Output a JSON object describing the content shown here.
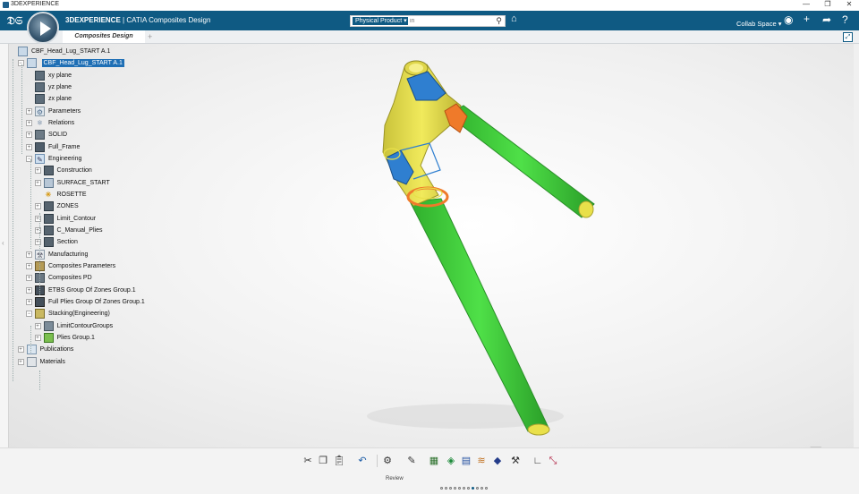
{
  "window": {
    "title": "3DEXPERIENCE",
    "minimize": "—",
    "restore": "❐",
    "close": "✕"
  },
  "topbar": {
    "brand_bold": "3DEXPERIENCE",
    "brand_rest": " | CATIA Composites Design",
    "search_scope": "Physical Product ▾",
    "search_placeholder": "in",
    "collab_space": "Collab Space ▾",
    "accent_color": "#0f5a83"
  },
  "tabs": {
    "active": "Composites Design",
    "add": "+"
  },
  "tree": [
    {
      "label": "CBF_Head_Lug_START A.1",
      "level": 0,
      "icon": "product-icon",
      "expander": "",
      "selected": false
    },
    {
      "label": "CBF_Head_Lug_START A.1",
      "level": 1,
      "icon": "part-icon",
      "expander": "−",
      "selected": true
    },
    {
      "label": "xy plane",
      "level": 2,
      "icon": "plane-icon",
      "expander": "",
      "selected": false
    },
    {
      "label": "yz plane",
      "level": 2,
      "icon": "plane-icon",
      "expander": "",
      "selected": false
    },
    {
      "label": "zx plane",
      "level": 2,
      "icon": "plane-icon",
      "expander": "",
      "selected": false
    },
    {
      "label": "Parameters",
      "level": 2,
      "icon": "parameters-icon",
      "expander": "+",
      "selected": false
    },
    {
      "label": "Relations",
      "level": 2,
      "icon": "relations-icon",
      "expander": "+",
      "selected": false
    },
    {
      "label": "SOLID",
      "level": 2,
      "icon": "solid-icon",
      "expander": "+",
      "selected": false
    },
    {
      "label": "Full_Frame",
      "level": 2,
      "icon": "frame-icon",
      "expander": "+",
      "selected": false
    },
    {
      "label": "Engineering",
      "level": 2,
      "icon": "engineering-icon",
      "expander": "−",
      "selected": false
    },
    {
      "label": "Construction",
      "level": 3,
      "icon": "geoset-icon",
      "expander": "+",
      "selected": false
    },
    {
      "label": "SURFACE_START",
      "level": 3,
      "icon": "surface-icon",
      "expander": "+",
      "selected": false
    },
    {
      "label": "ROSETTE",
      "level": 3,
      "icon": "rosette-icon",
      "expander": "",
      "selected": false
    },
    {
      "label": "ZONES",
      "level": 3,
      "icon": "geoset-icon",
      "expander": "+",
      "selected": false
    },
    {
      "label": "Limit_Contour",
      "level": 3,
      "icon": "geoset-icon",
      "expander": "+",
      "selected": false
    },
    {
      "label": "C_Manual_Plies",
      "level": 3,
      "icon": "geoset-icon",
      "expander": "+",
      "selected": false
    },
    {
      "label": "Section",
      "level": 3,
      "icon": "geoset-icon",
      "expander": "+",
      "selected": false
    },
    {
      "label": "Manufacturing",
      "level": 2,
      "icon": "manufacturing-icon",
      "expander": "+",
      "selected": false
    },
    {
      "label": "Composites Parameters",
      "level": 2,
      "icon": "composites-parameters-icon",
      "expander": "+",
      "selected": false
    },
    {
      "label": "Composites PD",
      "level": 2,
      "icon": "composites-pd-icon",
      "expander": "+",
      "selected": false
    },
    {
      "label": "ETBS Group Of Zones Group.1",
      "level": 2,
      "icon": "zones-group-icon",
      "expander": "+",
      "selected": false
    },
    {
      "label": "Full Plies Group Of Zones Group.1",
      "level": 2,
      "icon": "zones-group-icon",
      "expander": "+",
      "selected": false
    },
    {
      "label": "Stacking(Engineering)",
      "level": 2,
      "icon": "stacking-icon",
      "expander": "−",
      "selected": false
    },
    {
      "label": "LimitContourGroups",
      "level": 3,
      "icon": "limit-contour-groups-icon",
      "expander": "+",
      "selected": false
    },
    {
      "label": "Plies Group.1",
      "level": 3,
      "icon": "plies-group-icon",
      "expander": "+",
      "selected": false
    },
    {
      "label": "Publications",
      "level": 1,
      "icon": "publications-icon",
      "expander": "+",
      "selected": false
    },
    {
      "label": "Materials",
      "level": 1,
      "icon": "materials-icon",
      "expander": "+",
      "selected": false
    }
  ],
  "model": {
    "green": "#3cc93a",
    "yellow": "#e9e04a",
    "blue": "#2f7fd0",
    "orange": "#ef7a2a"
  },
  "action_bar": {
    "section_label": "Review",
    "page_dots": 11,
    "active_dot": 7
  }
}
